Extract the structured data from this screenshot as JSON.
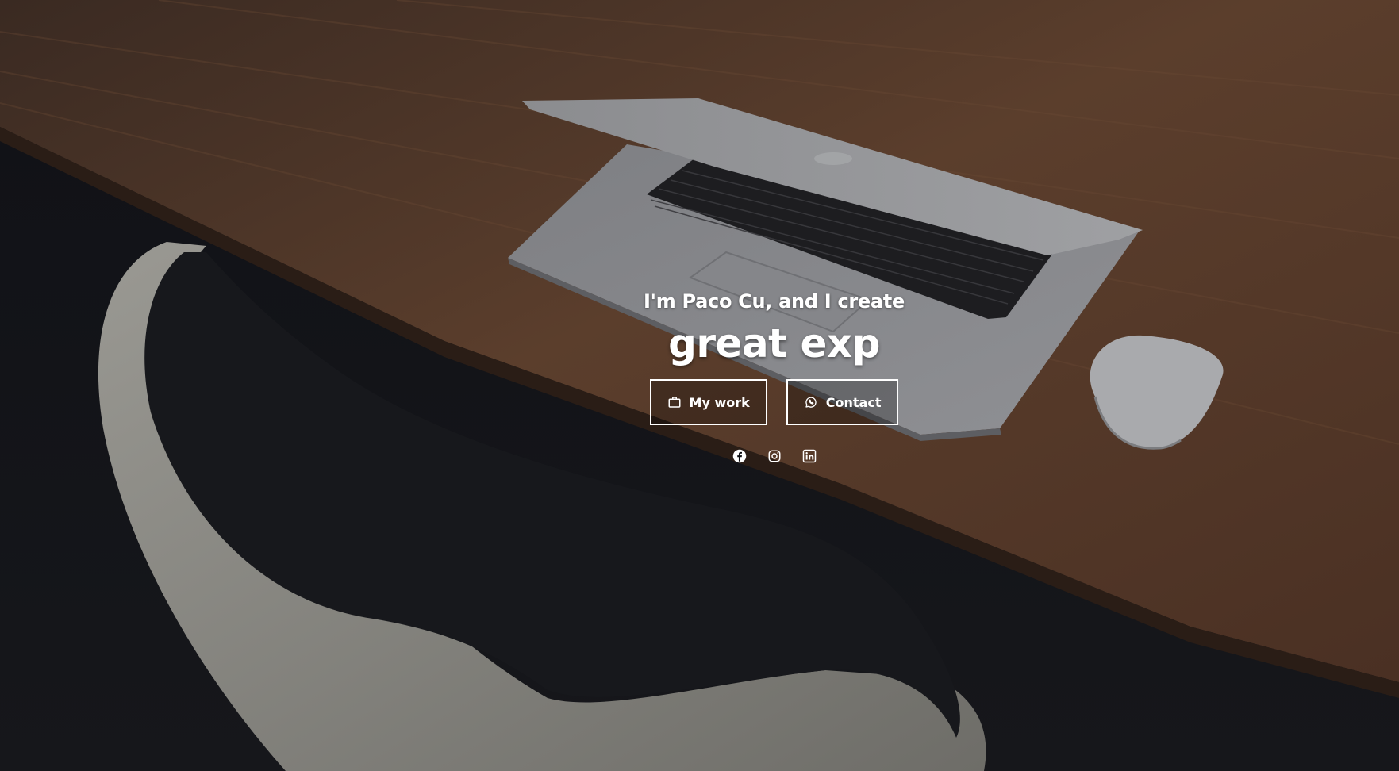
{
  "hero": {
    "intro": "I'm Paco Cu, and I create",
    "headline": "great exp"
  },
  "actions": {
    "work_label": "My work",
    "contact_label": "Contact"
  },
  "icons": {
    "work": "briefcase-icon",
    "contact": "whatsapp-icon",
    "socials": [
      "facebook-icon",
      "instagram-icon",
      "linkedin-icon"
    ]
  },
  "colors": {
    "text": "#ffffff",
    "overlay": "#0b0c10",
    "desk": "#5a3e2b"
  }
}
